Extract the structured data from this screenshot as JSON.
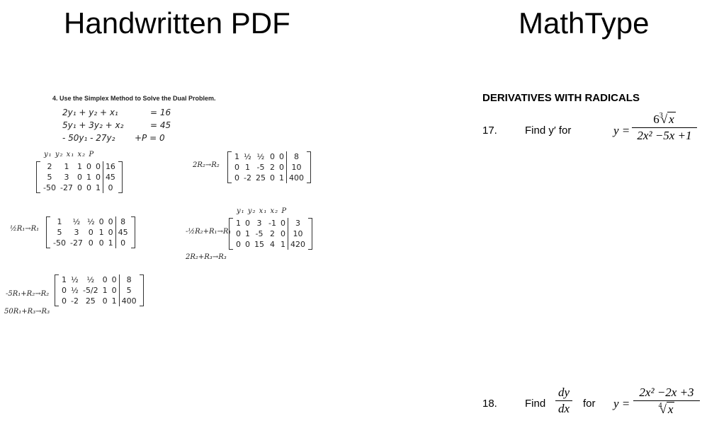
{
  "headings": {
    "left": "Handwritten PDF",
    "right": "MathType"
  },
  "handwritten": {
    "task_title": "4.  Use the Simplex Method to Solve the Dual Problem.",
    "equations": [
      {
        "lhs": "2y₁ + y₂ + x₁",
        "rhs": "= 16"
      },
      {
        "lhs": "5y₁ + 3y₂      + x₂",
        "rhs": "= 45"
      },
      {
        "lhs": "- 50y₁ - 27y₂",
        "rhs": "+P = 0"
      }
    ],
    "col_header": "y₁  y₂   x₁   x₂  P",
    "col_header2": "y₁  y₂   x₁  x₂  P",
    "ops": {
      "m2": "½R₁→R₁",
      "m3a": "-5R₁+R₂→R₂",
      "m3b": "50R₁+R₃→R₃",
      "m4": "2R₂→R₂",
      "m5a": "-½R₂+R₁→R₁",
      "m5b": "2R₂+R₃→R₃"
    },
    "matrices": {
      "m1": [
        [
          "2",
          "1",
          "1",
          "0",
          "0",
          "16"
        ],
        [
          "5",
          "3",
          "0",
          "1",
          "0",
          "45"
        ],
        [
          "-50",
          "-27",
          "0",
          "0",
          "1",
          "0"
        ]
      ],
      "m2": [
        [
          "1",
          "½",
          "½",
          "0",
          "0",
          "8"
        ],
        [
          "5",
          "3",
          "0",
          "1",
          "0",
          "45"
        ],
        [
          "-50",
          "-27",
          "0",
          "0",
          "1",
          "0"
        ]
      ],
      "m3": [
        [
          "1",
          "½",
          "½",
          "0",
          "0",
          "8"
        ],
        [
          "0",
          "½",
          "-5/2",
          "1",
          "0",
          "5"
        ],
        [
          "0",
          "-2",
          "25",
          "0",
          "1",
          "400"
        ]
      ],
      "m4": [
        [
          "1",
          "½",
          "½",
          "0",
          "0",
          "8"
        ],
        [
          "0",
          "1",
          "-5",
          "2",
          "0",
          "10"
        ],
        [
          "0",
          "-2",
          "25",
          "0",
          "1",
          "400"
        ]
      ],
      "m5": [
        [
          "1",
          "0",
          "3",
          "-1",
          "0",
          "3"
        ],
        [
          "0",
          "1",
          "-5",
          "2",
          "0",
          "10"
        ],
        [
          "0",
          "0",
          "15",
          "4",
          "1",
          "420"
        ]
      ]
    }
  },
  "mathtype": {
    "section_title": "DERIVATIVES WITH RADICALS",
    "problems": [
      {
        "number": "17.",
        "prompt": "Find y′  for",
        "lhs": "y =",
        "num_coef": "6",
        "num_index": "3",
        "num_radicand": "x",
        "den": "2x² −5x +1"
      },
      {
        "number": "18.",
        "prompt": "Find",
        "deriv_num": "dy",
        "deriv_den": "dx",
        "for": "for",
        "lhs": "y =",
        "num": "2x² −2x +3",
        "den_index": "4",
        "den_radicand": "x"
      }
    ]
  }
}
